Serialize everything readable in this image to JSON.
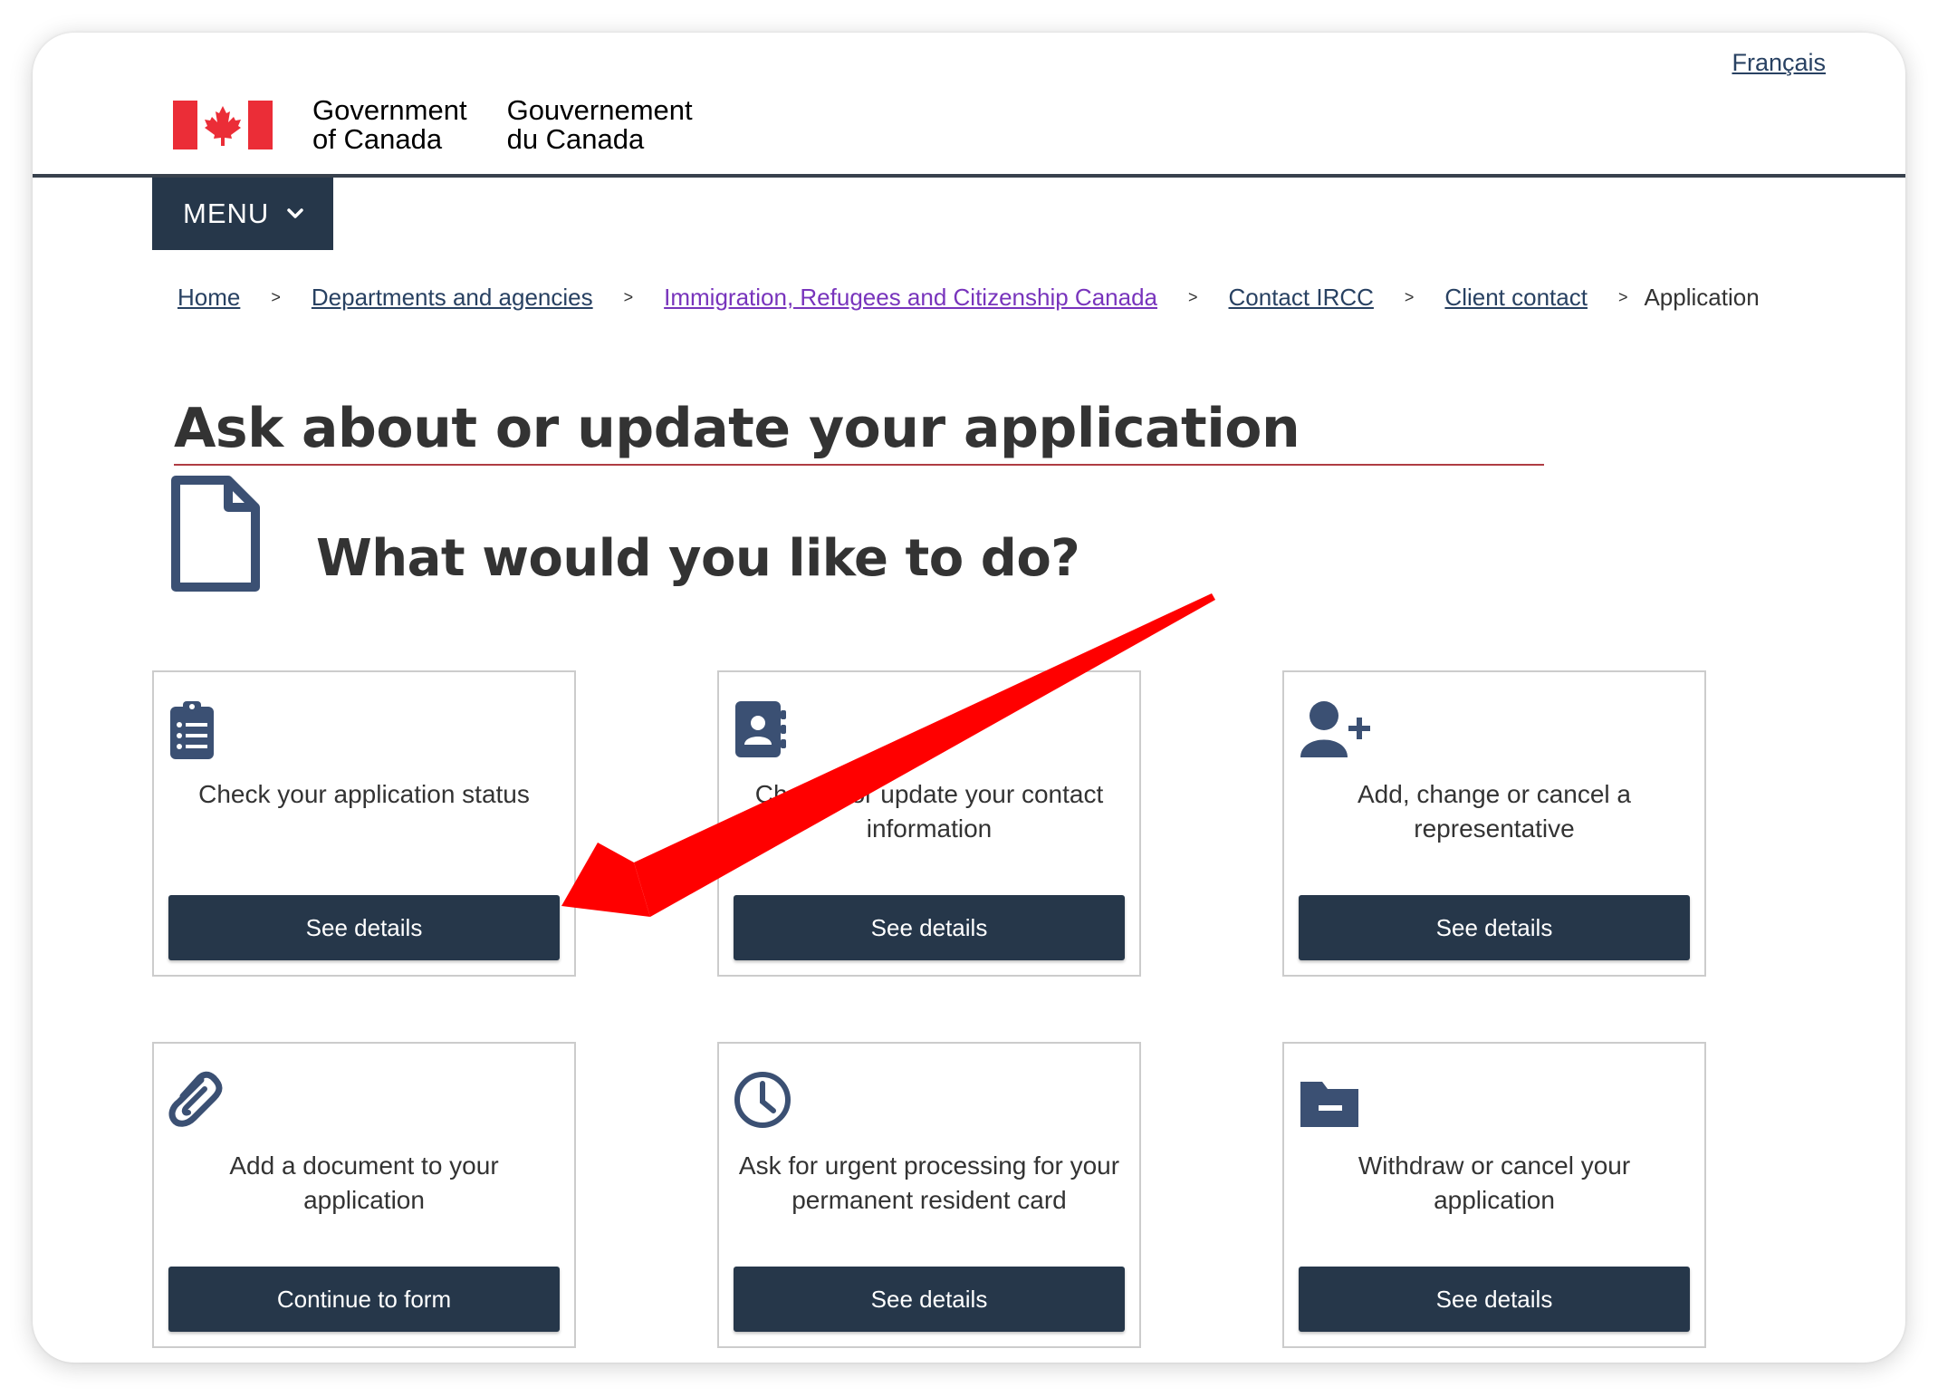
{
  "header": {
    "language_link": "Français",
    "signature_en_line1": "Government",
    "signature_en_line2": "of Canada",
    "signature_fr_line1": "Gouvernement",
    "signature_fr_line2": "du Canada",
    "menu_label": "MENU"
  },
  "breadcrumb": {
    "items": [
      "Home",
      "Departments and agencies",
      "Immigration, Refugees and Citizenship Canada",
      "Contact IRCC",
      "Client contact"
    ],
    "separator": ">",
    "current": "Application"
  },
  "main": {
    "title": "Ask about or update your application",
    "subtitle": "What would you like to do?"
  },
  "cards": [
    {
      "label": "Check your application status",
      "button": "See details",
      "icon": "clipboard-list-icon"
    },
    {
      "label": "Change or update your contact information",
      "button": "See details",
      "icon": "address-book-icon"
    },
    {
      "label": "Add, change or cancel a representative",
      "button": "See details",
      "icon": "user-plus-icon"
    },
    {
      "label": "Add a document to your application",
      "button": "Continue to form",
      "icon": "paperclip-icon"
    },
    {
      "label": "Ask for urgent processing for your permanent resident card",
      "button": "See details",
      "icon": "clock-icon"
    },
    {
      "label": "Withdraw or cancel your application",
      "button": "See details",
      "icon": "folder-minus-icon"
    }
  ],
  "colors": {
    "navy": "#26374a",
    "link": "#284162",
    "visited_link": "#7834bc",
    "flag_red": "#eb2d37",
    "title_rule": "#af3c43",
    "annotation_arrow": "#ff0000"
  }
}
